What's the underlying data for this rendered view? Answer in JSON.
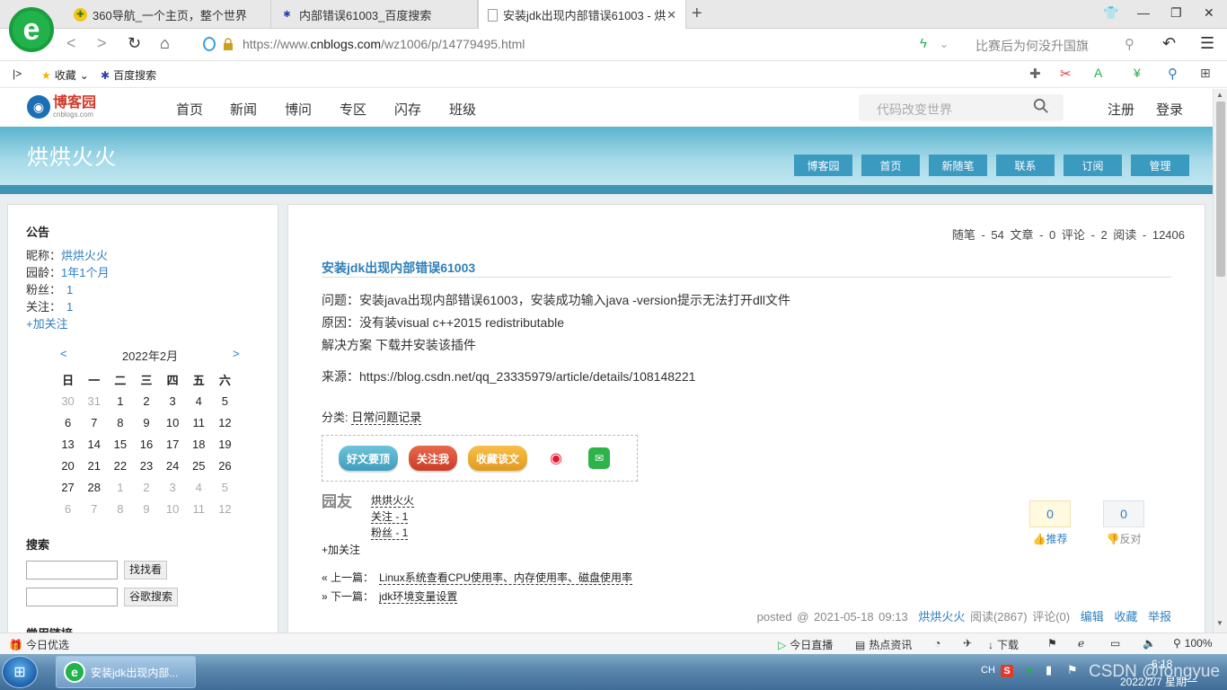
{
  "browser": {
    "tabs": [
      {
        "title": "360导航_一个主页，整个世界"
      },
      {
        "title": "内部错误61003_百度搜索"
      },
      {
        "title": "安装jdk出现内部错误61003 - 烘"
      }
    ],
    "url_scheme": "https://www.",
    "url_host": "cnblogs.com",
    "url_path": "/wz1006/p/14779495.html",
    "hot_search": "比赛后为何没升国旗",
    "bookmarks": {
      "favorites": "收藏",
      "baidu": "百度搜索"
    }
  },
  "site": {
    "logo_text": "博客园",
    "logo_sub": "cnblogs.com",
    "nav": [
      "首页",
      "新闻",
      "博问",
      "专区",
      "闪存",
      "班级"
    ],
    "search_placeholder": "代码改变世界",
    "register": "注册",
    "login": "登录"
  },
  "blog": {
    "title": "烘烘火火",
    "nav": [
      "博客园",
      "首页",
      "新随笔",
      "联系",
      "订阅",
      "管理"
    ]
  },
  "sidebar": {
    "notice_heading": "公告",
    "nickname_label": "昵称：",
    "nickname": "烘烘火火",
    "age_label": "园龄：",
    "age": "1年1个月",
    "fans_label": "粉丝：",
    "fans": "1",
    "follow_label": "关注：",
    "follow": "1",
    "add_follow": "+加关注",
    "calendar": {
      "prev": "<",
      "next": ">",
      "title": "2022年2月",
      "weekdays": [
        "日",
        "一",
        "二",
        "三",
        "四",
        "五",
        "六"
      ],
      "weeks": [
        [
          {
            "d": "30",
            "o": true
          },
          {
            "d": "31",
            "o": true
          },
          {
            "d": "1"
          },
          {
            "d": "2"
          },
          {
            "d": "3"
          },
          {
            "d": "4"
          },
          {
            "d": "5"
          }
        ],
        [
          {
            "d": "6"
          },
          {
            "d": "7"
          },
          {
            "d": "8"
          },
          {
            "d": "9"
          },
          {
            "d": "10"
          },
          {
            "d": "11"
          },
          {
            "d": "12"
          }
        ],
        [
          {
            "d": "13"
          },
          {
            "d": "14"
          },
          {
            "d": "15"
          },
          {
            "d": "16"
          },
          {
            "d": "17"
          },
          {
            "d": "18"
          },
          {
            "d": "19"
          }
        ],
        [
          {
            "d": "20"
          },
          {
            "d": "21"
          },
          {
            "d": "22"
          },
          {
            "d": "23"
          },
          {
            "d": "24"
          },
          {
            "d": "25"
          },
          {
            "d": "26"
          }
        ],
        [
          {
            "d": "27"
          },
          {
            "d": "28"
          },
          {
            "d": "1",
            "o": true
          },
          {
            "d": "2",
            "o": true
          },
          {
            "d": "3",
            "o": true
          },
          {
            "d": "4",
            "o": true
          },
          {
            "d": "5",
            "o": true
          }
        ],
        [
          {
            "d": "6",
            "o": true
          },
          {
            "d": "7",
            "o": true
          },
          {
            "d": "8",
            "o": true
          },
          {
            "d": "9",
            "o": true
          },
          {
            "d": "10",
            "o": true
          },
          {
            "d": "11",
            "o": true
          },
          {
            "d": "12",
            "o": true
          }
        ]
      ]
    },
    "search_heading": "搜索",
    "search_btn": "找找看",
    "google_btn": "谷歌搜索",
    "links_heading": "常用链接"
  },
  "stats": "随笔 - 54  文章 - 0  评论 - 2  阅读 - 12406",
  "post": {
    "title": "安装jdk出现内部错误61003",
    "lines": [
      "问题：安装java出现内部错误61003，安装成功输入java -version提示无法打开dll文件",
      "原因：没有装visual c++2015 redistributable",
      "解决方案 下载并安装该插件",
      "来源：https://blog.csdn.net/qq_23335979/article/details/108148221"
    ],
    "category_label": "分类: ",
    "category": "日常问题记录",
    "share": {
      "good": "好文要顶",
      "follow": "关注我",
      "collect": "收藏该文"
    },
    "author": {
      "name": "烘烘火火",
      "follow": "关注 - 1",
      "fans": "粉丝 - 1",
      "avatar_text": "园友",
      "add_follow": "+加关注"
    },
    "votes": {
      "up": "0",
      "up_label": "推荐",
      "down": "0",
      "down_label": "反对"
    },
    "prev_label": "« 上一篇：",
    "prev": "Linux系统查看CPU使用率、内存使用率、磁盘使用率",
    "next_label": "» 下一篇：",
    "next": "jdk环境变量设置",
    "footer": {
      "posted": "posted @ 2021-05-18 09:13",
      "author": "烘烘火火",
      "reads": "阅读(2867)",
      "comments": "评论(0)",
      "edit": "编辑",
      "collect": "收藏",
      "report": "举报"
    }
  },
  "statusbar": {
    "left": "今日优选",
    "live": "今日直播",
    "news": "热点资讯",
    "download": "下载",
    "zoom": "100%"
  },
  "taskbar": {
    "task": "安装jdk出现内部...",
    "ime": "CH",
    "time": "6:18",
    "date": "2022/2/7 星期一",
    "watermark": "CSDN @fongyue"
  },
  "colors": {
    "accent": "#2f7fbf",
    "banner": "#5ab4ce",
    "blog_nav": "#3a9ac0"
  }
}
